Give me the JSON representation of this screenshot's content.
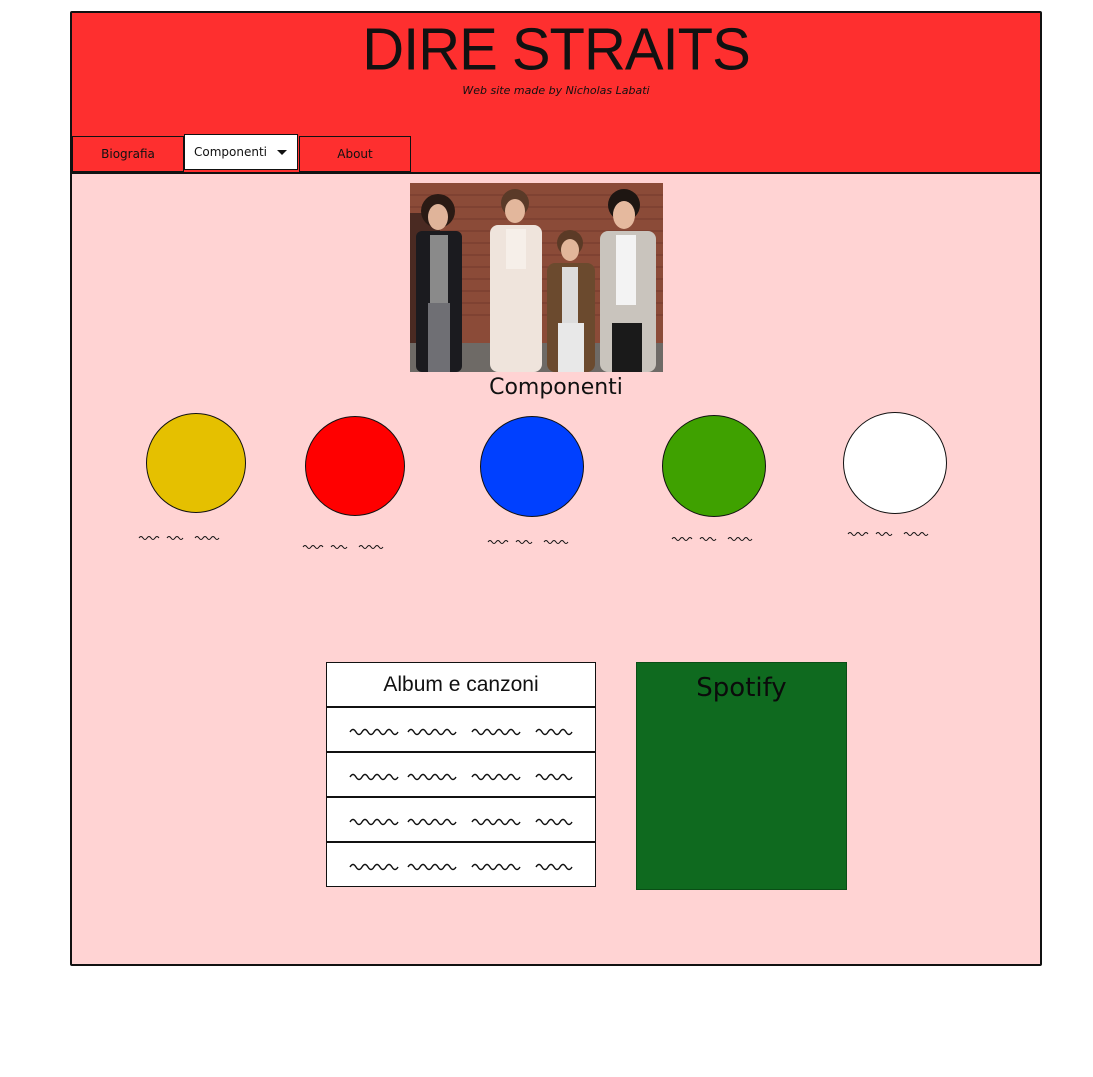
{
  "header": {
    "title": "DIRE STRAITS",
    "subtitle": "Web site made by Nicholas Labati"
  },
  "nav": {
    "biografia": "Biografia",
    "componenti": "Componenti",
    "about": "About"
  },
  "main": {
    "section_title": "Componenti",
    "members": [
      {
        "color": "#e5c000"
      },
      {
        "color": "#ff0000"
      },
      {
        "color": "#0040ff"
      },
      {
        "color": "#3fa100"
      },
      {
        "color": "#ffffff"
      }
    ]
  },
  "albums": {
    "header": "Album e canzoni"
  },
  "spotify": {
    "label": "Spotify",
    "color": "#0f6a1f"
  }
}
